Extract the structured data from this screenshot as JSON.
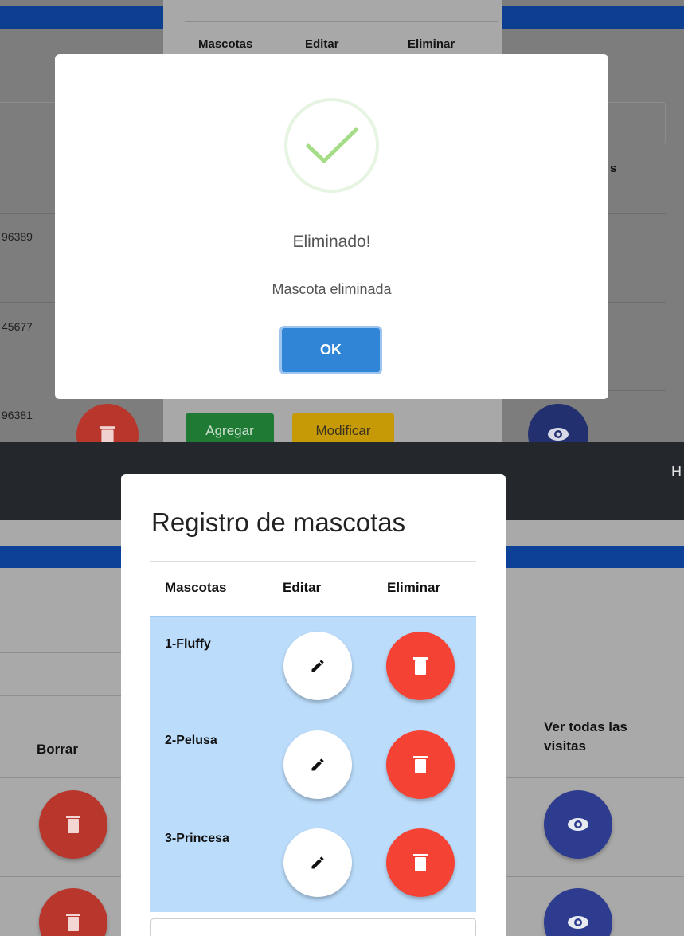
{
  "top_panel": {
    "table_headers": [
      "Mascotas",
      "Editar",
      "Eliminar"
    ],
    "background_column_hint": "s",
    "phone_fragments": [
      "96389",
      "45677",
      "96381"
    ],
    "buttons": {
      "add": "Agregar",
      "modify": "Modificar"
    },
    "alert": {
      "title": "Eliminado!",
      "text": "Mascota eliminada",
      "confirm": "OK",
      "icon": "success-check-icon"
    }
  },
  "bottom_panel": {
    "navbar_letter": "H",
    "background": {
      "delete_column": "Borrar",
      "visits_column": "Ver todas las visitas"
    },
    "modal": {
      "title": "Registro de mascotas",
      "headers": {
        "pets": "Mascotas",
        "edit": "Editar",
        "delete": "Eliminar"
      },
      "pets": [
        {
          "label": "1-Fluffy"
        },
        {
          "label": "2-Pelusa"
        },
        {
          "label": "3-Princesa"
        }
      ]
    }
  },
  "colors": {
    "primary_blue": "#3085d6",
    "danger_red": "#f44335",
    "row_highlight": "#bbdcfb",
    "success_green": "#a5dc86",
    "indigo": "#2d3c8f",
    "navbar": "#24272b"
  }
}
